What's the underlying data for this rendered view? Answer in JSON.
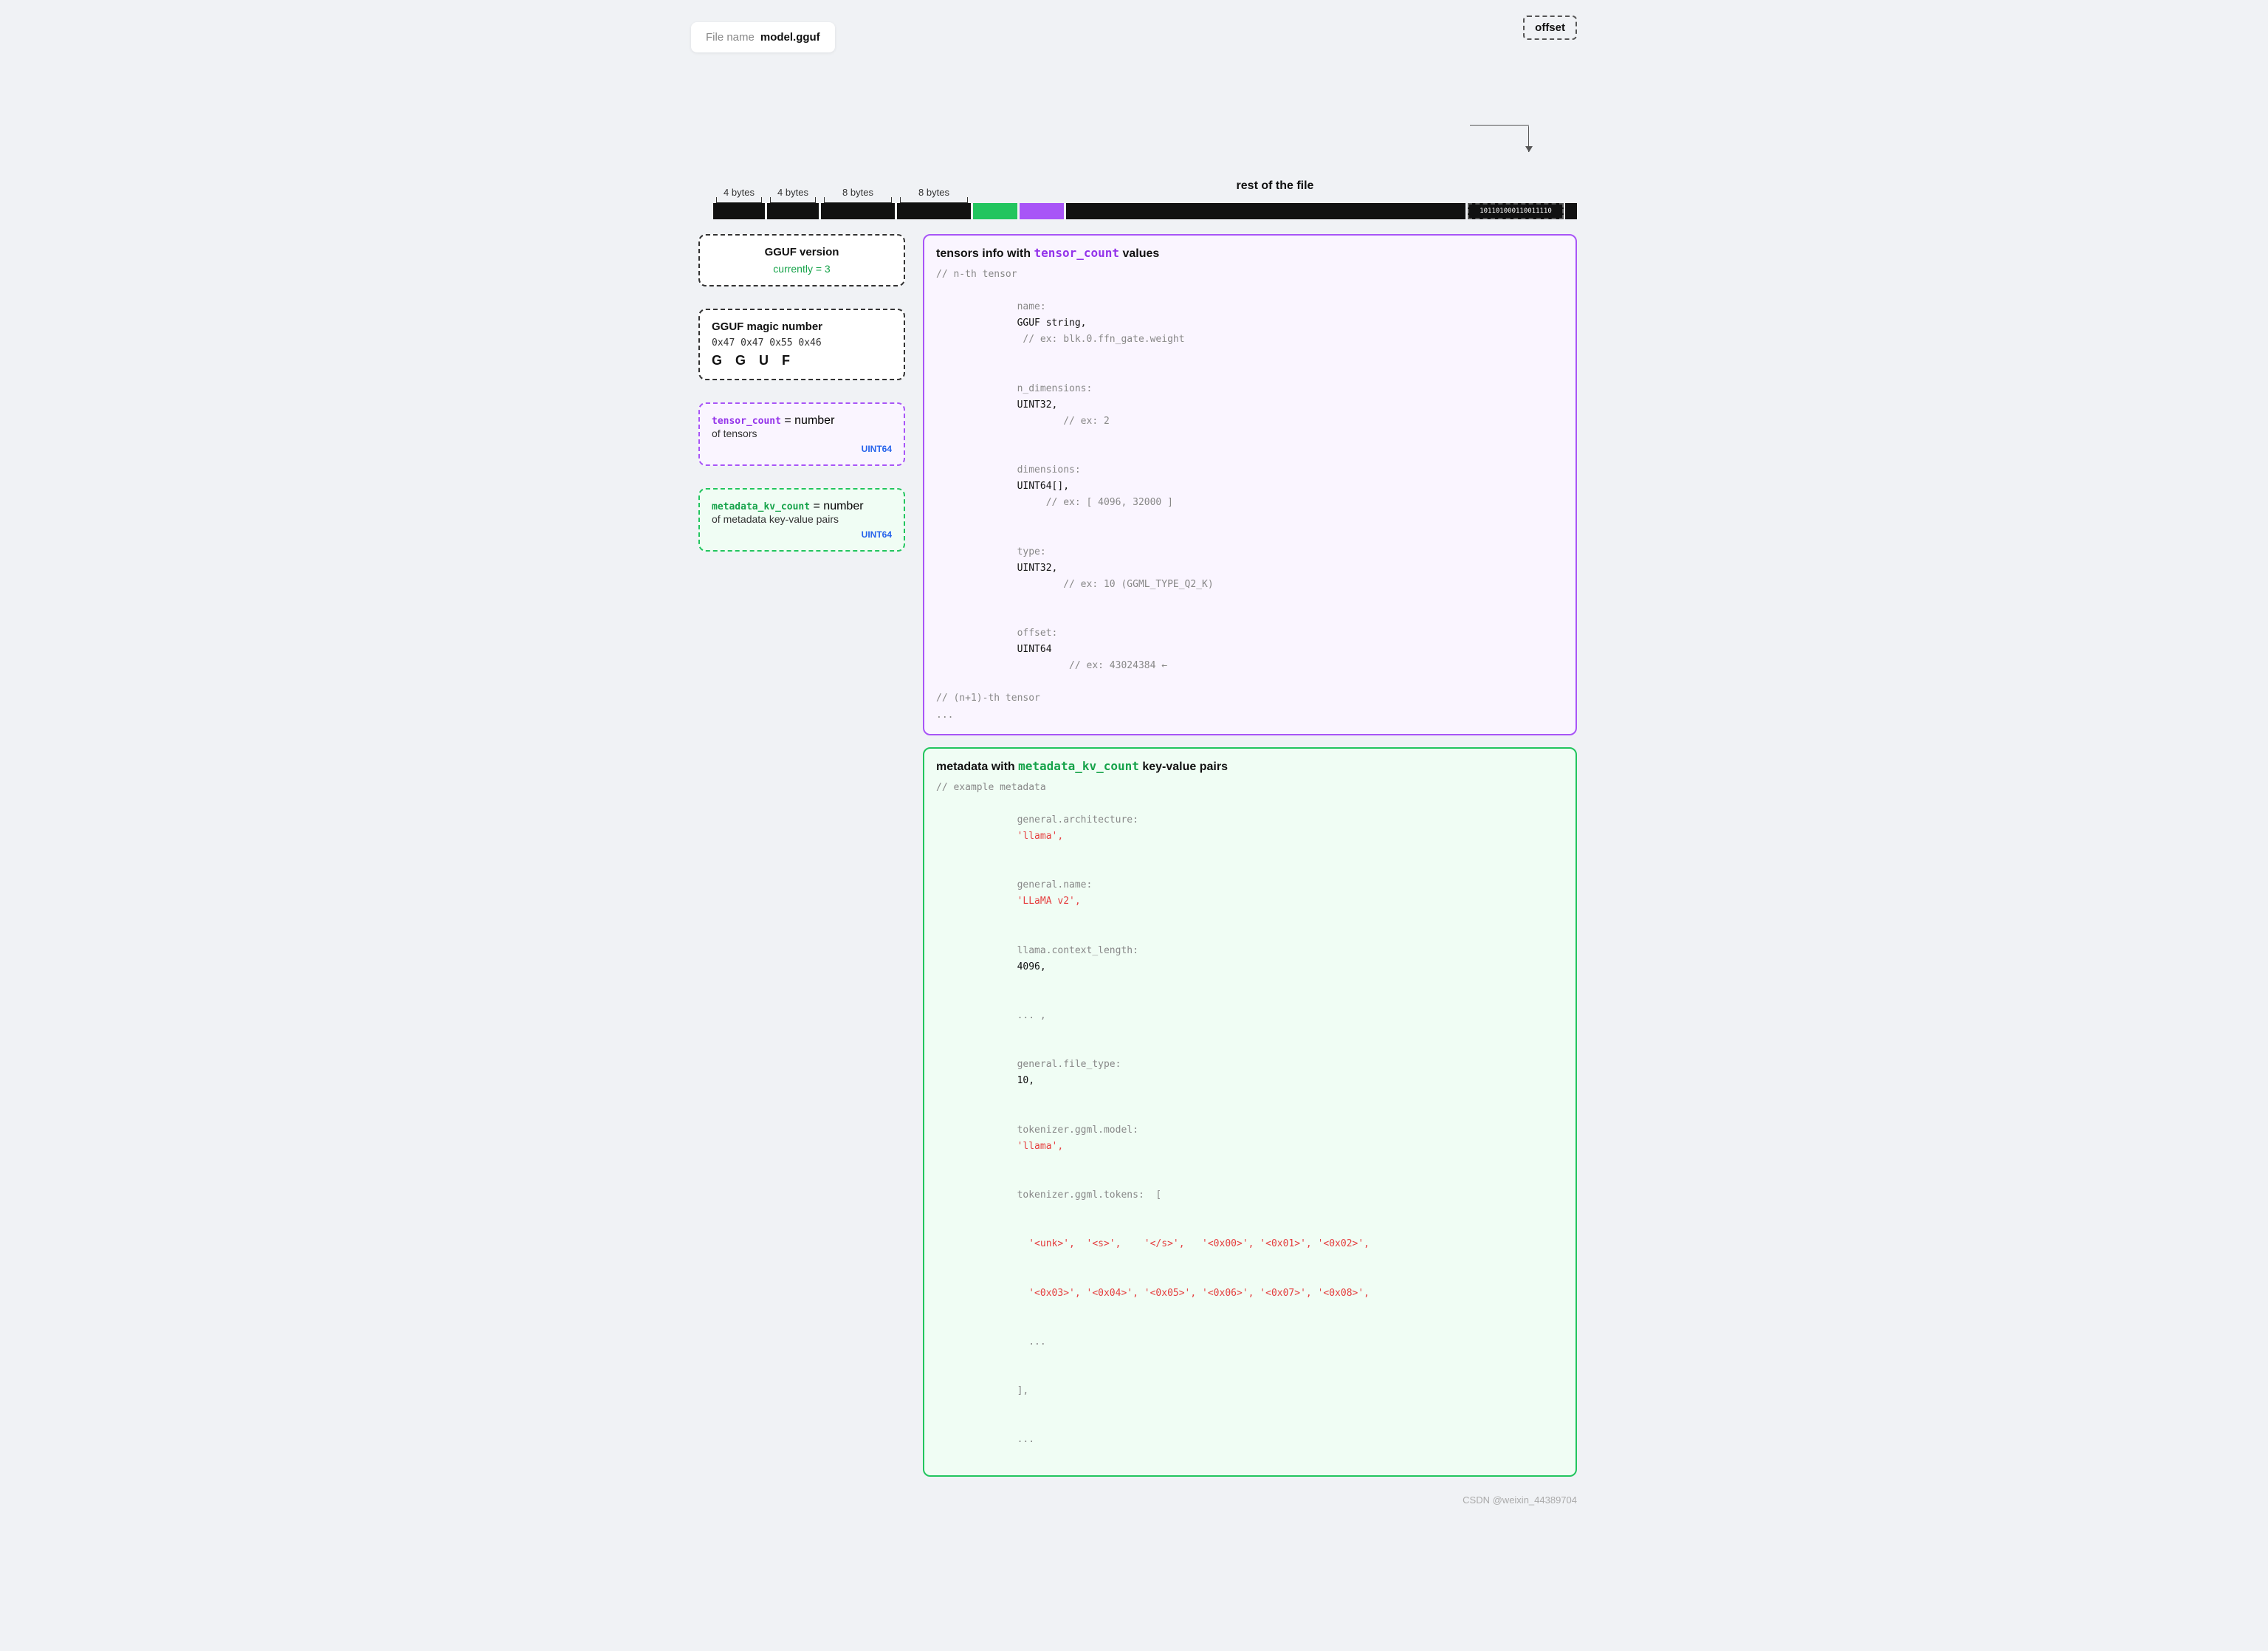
{
  "header": {
    "file_label": "File name",
    "file_name": "model.gguf"
  },
  "byte_labels": [
    {
      "text": "4 bytes",
      "width": 70
    },
    {
      "text": "4 bytes",
      "width": 70
    },
    {
      "text": "8 bytes",
      "width": 100
    },
    {
      "text": "8 bytes",
      "width": 100
    }
  ],
  "rest_label": "rest of the file",
  "offset_label": "offset",
  "binary_text": "101101000110011110",
  "left_boxes": {
    "gguf_magic": {
      "title": "GGUF magic number",
      "hex": "0x47 0x47 0x55 0x46",
      "letters": [
        "G",
        "G",
        "U",
        "F"
      ]
    },
    "gguf_version": {
      "title": "GGUF version",
      "subtitle": "currently = 3"
    },
    "tensor_count": {
      "title": "tensor_count",
      "equals": "= number",
      "subtitle": "of tensors",
      "type": "UINT64"
    },
    "metadata_kv_count": {
      "title": "metadata_kv_count",
      "equals": "= number",
      "subtitle": "of metadata key-value pairs",
      "type": "UINT64"
    }
  },
  "tensors_box": {
    "title_plain": "tensors info with ",
    "title_code": "tensor_count",
    "title_end": " values",
    "comment1": "// n-th tensor",
    "fields": [
      {
        "key": "name:",
        "type": "GGUF string,",
        "comment": "// ex: blk.0.ffn_gate.weight"
      },
      {
        "key": "n_dimensions:",
        "type": "UINT32,",
        "comment": "// ex: 2"
      },
      {
        "key": "dimensions:",
        "type": "UINT64[],",
        "comment": "// ex: [ 4096, 32000 ]"
      },
      {
        "key": "type:",
        "type": "UINT32,",
        "comment": "// ex: 10 (GGML_TYPE_Q2_K)"
      },
      {
        "key": "offset:",
        "type": "UINT64",
        "comment": "// ex: 43024384 ←"
      }
    ],
    "comment2": "// (n+1)-th tensor",
    "ellipsis": "..."
  },
  "metadata_box": {
    "title_plain": "metadata with ",
    "title_code": "metadata_kv_count",
    "title_end": " key-value pairs",
    "comment1": "// example metadata",
    "lines": [
      {
        "key": "general.architecture:",
        "value": "'llama',"
      },
      {
        "key": "general.name:",
        "value": "'LLaMA v2',"
      },
      {
        "key": "llama.context_length:",
        "value": "4096,"
      },
      {
        "key": "... ,",
        "value": ""
      },
      {
        "key": "general.file_type:",
        "value": "10,"
      },
      {
        "key": "tokenizer.ggml.model:",
        "value": "'llama',"
      },
      {
        "key": "tokenizer.ggml.tokens:",
        "value": "["
      },
      {
        "key": "  '<unk>',  '<s>',    '</s>',   '<0x00>', '<0x01>', '<0x02>',",
        "value": ""
      },
      {
        "key": "  '<0x03>', '<0x04>', '<0x05>', '<0x06>', '<0x07>', '<0x08>',",
        "value": ""
      },
      {
        "key": "  ...",
        "value": ""
      },
      {
        "key": "],",
        "value": ""
      },
      {
        "key": "...",
        "value": ""
      }
    ]
  },
  "watermark": "CSDN @weixin_44389704"
}
